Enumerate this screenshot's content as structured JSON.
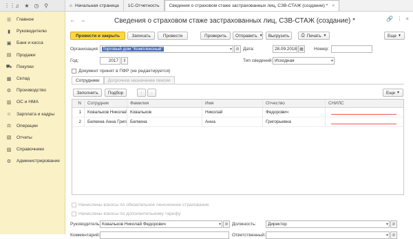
{
  "topbar": {
    "icons": [
      "apps-icon",
      "bell-icon",
      "star-icon",
      "history-icon",
      "search-icon"
    ],
    "tabs": [
      {
        "label": "Начальная страница"
      },
      {
        "label": "1С-Отчетность"
      },
      {
        "label": "Сведения о страховом стаже застрахованных лиц, СЗВ-СТАЖ (создание) *",
        "close": "×"
      }
    ]
  },
  "sidebar": {
    "items": [
      {
        "label": "Главное",
        "icon": "menu-icon"
      },
      {
        "label": "Руководителю",
        "icon": "chart-icon"
      },
      {
        "label": "Банк и касса",
        "icon": "bank-icon"
      },
      {
        "label": "Продажи",
        "icon": "sales-icon"
      },
      {
        "label": "Покупки",
        "icon": "cart-icon"
      },
      {
        "label": "Склад",
        "icon": "warehouse-icon"
      },
      {
        "label": "Производство",
        "icon": "production-icon"
      },
      {
        "label": "ОС и НМА",
        "icon": "assets-icon"
      },
      {
        "label": "Зарплата и кадры",
        "icon": "staff-icon"
      },
      {
        "label": "Операции",
        "icon": "operations-icon"
      },
      {
        "label": "Отчеты",
        "icon": "reports-icon"
      },
      {
        "label": "Справочники",
        "icon": "books-icon"
      },
      {
        "label": "Администрирование",
        "icon": "gear-icon"
      }
    ]
  },
  "form": {
    "title": "Сведения о страховом стаже застрахованных лиц, СЗВ-СТАЖ (создание) *",
    "toolbar": {
      "post_close": "Провести и закрыть",
      "save": "Записать",
      "post": "Провести",
      "check": "Проверить",
      "send": "Отправить",
      "upload": "Выгрузить",
      "print": "Печать",
      "more": "Еще"
    },
    "org_label": "Организация:",
    "org_value": "Торговый дом \"Комплексный\"",
    "date_label": "Дата:",
    "date_value": "28.09.2018",
    "number_label": "Номер:",
    "number_value": "",
    "year_label": "Год:",
    "year_value": "2017",
    "type_label": "Тип сведений:",
    "type_value": "Исходная",
    "accepted_label": "Документ принят в ПФР (не редактируется)",
    "tabs": [
      "Сотрудники",
      "Досрочное назначение пенсии"
    ],
    "fill_btn": "Заполнить",
    "select_btn": "Подбор",
    "table_more": "Еще",
    "columns": [
      "N",
      "Сотрудник",
      "Фамилия",
      "Имя",
      "Отчество",
      "СНИЛС"
    ],
    "rows": [
      {
        "n": "1",
        "employee": "Ковальков Николай ...",
        "last": "Ковальков",
        "first": "Николай",
        "middle": "Федорович",
        "snils": ""
      },
      {
        "n": "2",
        "employee": "Белкина Анна Григор...",
        "last": "Белкина",
        "first": "Анна",
        "middle": "Григорьевна",
        "snils": ""
      }
    ],
    "contrib_mandatory": "Начислены взносы по обязательное пенсионное страхование",
    "contrib_additional": "Начислены взносы по дополнительному тарифу",
    "head_label": "Руководитель:",
    "head_value": "Ковальков Николай Федорович",
    "position_label": "Должность:",
    "position_value": "Директор",
    "comment_label": "Комментарий:",
    "comment_value": "",
    "responsible_label": "Ответственный:",
    "responsible_value": ""
  }
}
